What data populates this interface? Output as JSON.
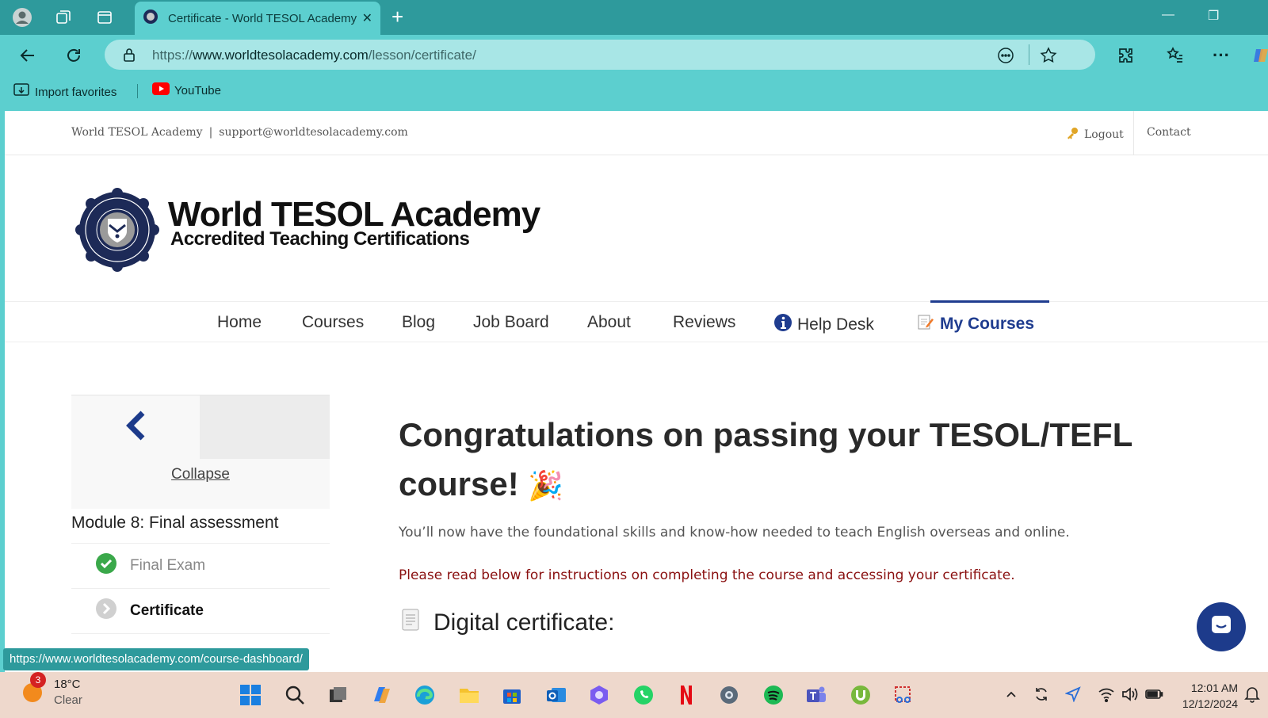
{
  "browser": {
    "tab_title": "Certificate - World TESOL Academy",
    "url_scheme": "https://",
    "url_host": "www.worldtesolacademy.com",
    "url_path": "/lesson/certificate/",
    "bookmarks": [
      {
        "label": "Import favorites",
        "icon": "import-favorites-icon"
      },
      {
        "label": "YouTube",
        "icon": "youtube-icon"
      }
    ],
    "status_link": "https://www.worldtesolacademy.com/course-dashboard/"
  },
  "site": {
    "topbar_name": "World TESOL Academy",
    "topbar_sep": "|",
    "topbar_email": "support@worldtesolacademy.com",
    "logout": "Logout",
    "contact": "Contact",
    "logo_title": "World TESOL Academy",
    "logo_subtitle": "Accredited Teaching Certifications",
    "logo_seal_text": "World TESOL Academy · Teaching Certifications",
    "nav": {
      "home": "Home",
      "courses": "Courses",
      "blog": "Blog",
      "job_board": "Job Board",
      "about": "About",
      "reviews": "Reviews",
      "help_desk": "Help Desk",
      "my_courses": "My Courses"
    }
  },
  "sidebar": {
    "collapse": "Collapse",
    "module": "Module 8: Final assessment",
    "lessons": [
      {
        "label": "Final Exam",
        "status": "completed"
      },
      {
        "label": "Certificate",
        "status": "current"
      }
    ]
  },
  "content": {
    "heading": "Congratulations on passing your TESOL/TEFL course!",
    "heading_emoji": "🎉",
    "intro": "You’ll now have the foundational skills and know-how needed to teach English overseas and online.",
    "notice": "Please read below for instructions on completing the course and accessing your certificate.",
    "subheading": "Digital certificate:"
  },
  "taskbar": {
    "weather_temp": "18°C",
    "weather_cond": "Clear",
    "weather_badge": "3",
    "time": "12:01 AM",
    "date": "12/12/2024"
  },
  "colors": {
    "browser_accent": "#5ccfcf",
    "brand_navy": "#1f3c8f",
    "notice_red": "#8a1010"
  }
}
